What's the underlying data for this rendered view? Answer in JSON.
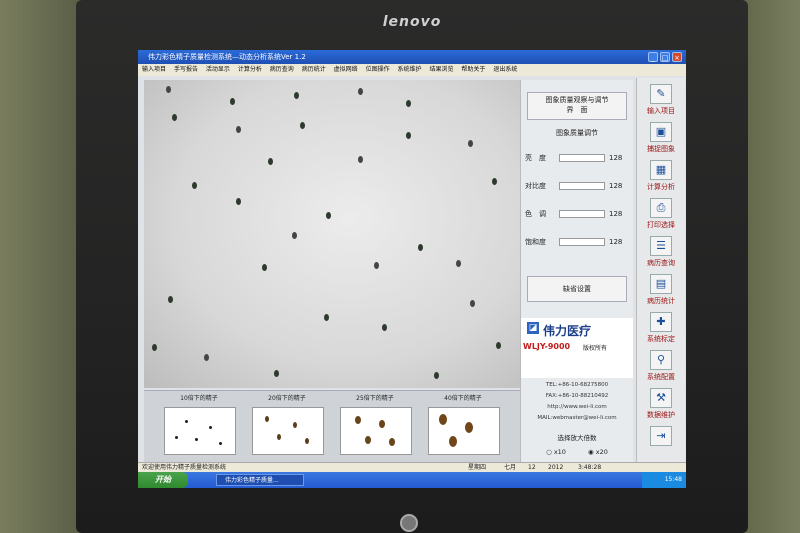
{
  "monitor": {
    "brand": "lenovo"
  },
  "window": {
    "title": "伟力彩色精子质量检测系统—动态分析系统Ver 1.2",
    "controls": [
      "_",
      "□",
      "×"
    ]
  },
  "menu": [
    "输入项目",
    "手写报告",
    "活动显示",
    "计算分析",
    "病历查询",
    "病历统计",
    "虚拟网络",
    "位图操作",
    "系统维护",
    "结果浏览",
    "帮助关于",
    "退出系统"
  ],
  "side": {
    "header": [
      "图象质量观察与调节",
      "界　面"
    ],
    "section": "图象质量调节",
    "controls": [
      {
        "label": "亮　度",
        "value": "128"
      },
      {
        "label": "对比度",
        "value": "128"
      },
      {
        "label": "色　调",
        "value": "128"
      },
      {
        "label": "饱和度",
        "value": "128"
      }
    ],
    "default_button": "缺省设置",
    "brand_cn": "伟力医疗",
    "brand_model": "WLJY-9000",
    "brand_rights": "版权所有",
    "contact": [
      "TEL:+86-10-68275800",
      "FAX:+86-10-88210492",
      "http://www.wei-li.com",
      "MAIL:webmaster@wei-li.com"
    ],
    "zoom_title": "选择放大倍数",
    "zoom_options": [
      "x10",
      "x20"
    ]
  },
  "thumbnails": [
    {
      "label": "10倍下的精子"
    },
    {
      "label": "20倍下的精子"
    },
    {
      "label": "25倍下的精子"
    },
    {
      "label": "40倍下的精子"
    }
  ],
  "toolbar": [
    {
      "label": "输入项目",
      "icon": "input-icon",
      "glyph": "✎"
    },
    {
      "label": "捕捉图象",
      "icon": "camera-icon",
      "glyph": "▣"
    },
    {
      "label": "计算分析",
      "icon": "calc-icon",
      "glyph": "▦"
    },
    {
      "label": "打印选择",
      "icon": "printer-icon",
      "glyph": "⎙"
    },
    {
      "label": "病历查询",
      "icon": "records-icon",
      "glyph": "☰"
    },
    {
      "label": "病历统计",
      "icon": "stats-icon",
      "glyph": "▤"
    },
    {
      "label": "系统标定",
      "icon": "calibrate-icon",
      "glyph": "✚"
    },
    {
      "label": "系统配置",
      "icon": "config-icon",
      "glyph": "⚲"
    },
    {
      "label": "数据维护",
      "icon": "maintenance-icon",
      "glyph": "⚒"
    },
    {
      "label": "",
      "icon": "exit-icon",
      "glyph": "⇥"
    }
  ],
  "status": {
    "message": "欢迎使用伟力精子质量检测系统",
    "day": "星期四",
    "month": "七月",
    "date": "12",
    "year": "2012",
    "time": "3:48:28"
  },
  "taskbar": {
    "start": "开始",
    "task": "伟力彩色精子质量...",
    "clock": "15:48"
  }
}
